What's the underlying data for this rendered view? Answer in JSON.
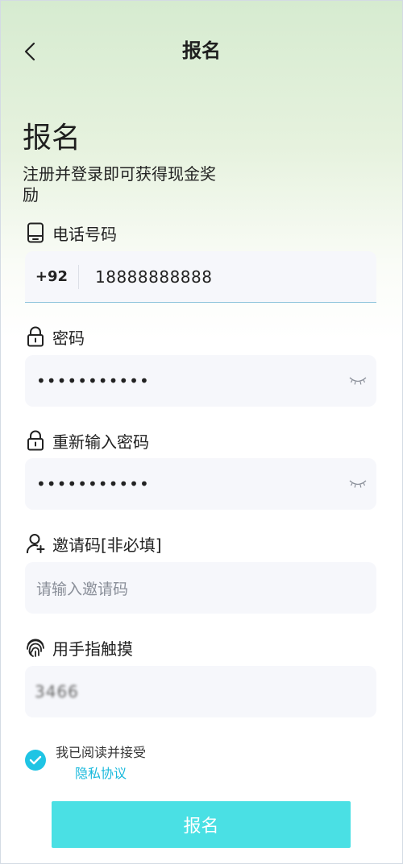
{
  "header": {
    "title": "报名"
  },
  "hero": {
    "title": "报名",
    "subtitle": "注册并登录即可获得现金奖励"
  },
  "phone": {
    "label": "电话号码",
    "country_code": "+92",
    "value": "18888888888",
    "icon": "phone-icon"
  },
  "password": {
    "label": "密码",
    "value": "•••••••••••",
    "icon": "lock-icon"
  },
  "confirm_password": {
    "label": "重新输入密码",
    "value": "•••••••••••",
    "icon": "lock-icon"
  },
  "invite": {
    "label": "邀请码[非必填]",
    "placeholder": "请输入邀请码",
    "icon": "user-add-icon"
  },
  "captcha": {
    "label": "用手指触摸",
    "value": "3466",
    "icon": "fingerprint-icon"
  },
  "agreement": {
    "text": "我已阅读并接受",
    "link": "隐私协议",
    "checked": true
  },
  "submit": {
    "label": "报名"
  },
  "colors": {
    "accent": "#4ae0e4",
    "link": "#18b9dc",
    "check": "#1fc4e4"
  }
}
